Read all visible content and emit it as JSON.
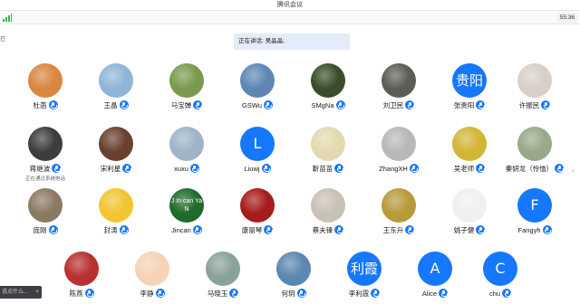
{
  "window": {
    "title": "腾讯会议"
  },
  "toolbar": {
    "time": "55:36"
  },
  "side_hint": "已",
  "speaking": {
    "prefix": "正在讲话:",
    "name": "吴晶晶;"
  },
  "participants": [
    {
      "name": "杜菡",
      "avatar": "photo",
      "bg": "#d9873f"
    },
    {
      "name": "王晶",
      "avatar": "photo",
      "bg": "#8fb6d8"
    },
    {
      "name": "马宝婵",
      "avatar": "photo",
      "bg": "#7a9a4f"
    },
    {
      "name": "GSWu",
      "avatar": "photo",
      "bg": "#5d86b5"
    },
    {
      "name": "SMgNa",
      "avatar": "photo",
      "bg": "#3a4d2a"
    },
    {
      "name": "刘卫民",
      "avatar": "photo",
      "bg": "#5a5e52"
    },
    {
      "name": "张贵阳",
      "avatar": "letter",
      "letter": "贵阳"
    },
    {
      "name": "许振民",
      "avatar": "photo",
      "bg": "#d9cfc9"
    },
    {
      "name": "蒋继波",
      "avatar": "photo",
      "bg": "#3b3d3f",
      "sub": "正在通过系统电话"
    },
    {
      "name": "宋利星",
      "avatar": "photo",
      "bg": "#6a4030"
    },
    {
      "name": "xuxu",
      "avatar": "photo",
      "bg": "#9fb4c8"
    },
    {
      "name": "Liuwj",
      "avatar": "letter",
      "letter": "L"
    },
    {
      "name": "靳苗苗",
      "avatar": "photo",
      "bg": "#e3d9b0"
    },
    {
      "name": "ZhangXH",
      "avatar": "photo",
      "bg": "#b8b8b8"
    },
    {
      "name": "吴老师",
      "avatar": "photo",
      "bg": "#d3b537"
    },
    {
      "name": "秦妍龙（怜恤）",
      "avatar": "photo",
      "bg": "#9aa88a"
    },
    {
      "name": "庞刚",
      "avatar": "photo",
      "bg": "#8b7a63"
    },
    {
      "name": "封涛",
      "avatar": "photo",
      "bg": "#f2c531"
    },
    {
      "name": "Jincan",
      "avatar": "photo",
      "bg": "#1f6b2c",
      "text": "J In can Ya N"
    },
    {
      "name": "康丽琴",
      "avatar": "photo",
      "bg": "#a61c1c"
    },
    {
      "name": "蔡夫锋",
      "avatar": "photo",
      "bg": "#c8c1b6"
    },
    {
      "name": "王东升",
      "avatar": "photo",
      "bg": "#b79a3a"
    },
    {
      "name": "姚子健",
      "avatar": "photo",
      "bg": "#f0f0f0"
    },
    {
      "name": "Fangyh",
      "avatar": "letter",
      "letter": "F"
    },
    {
      "name": "陈燕",
      "avatar": "photo",
      "bg": "#b83030"
    },
    {
      "name": "李静",
      "avatar": "photo",
      "bg": "#f5d3b5"
    },
    {
      "name": "马晓玉",
      "avatar": "photo",
      "bg": "#8aa39a"
    },
    {
      "name": "何玥",
      "avatar": "photo",
      "bg": "#5b88b0"
    },
    {
      "name": "李利霞",
      "avatar": "letter",
      "letter": "利霞"
    },
    {
      "name": "Alice",
      "avatar": "letter",
      "letter": "A"
    },
    {
      "name": "chu",
      "avatar": "letter",
      "letter": "C"
    }
  ],
  "chat": {
    "placeholder": "说点什么...",
    "close": "×"
  },
  "icons": {
    "mic": "mic-icon",
    "signal": "signal-icon"
  },
  "colors": {
    "accent": "#1677ff",
    "signal": "#2dbd4d"
  }
}
